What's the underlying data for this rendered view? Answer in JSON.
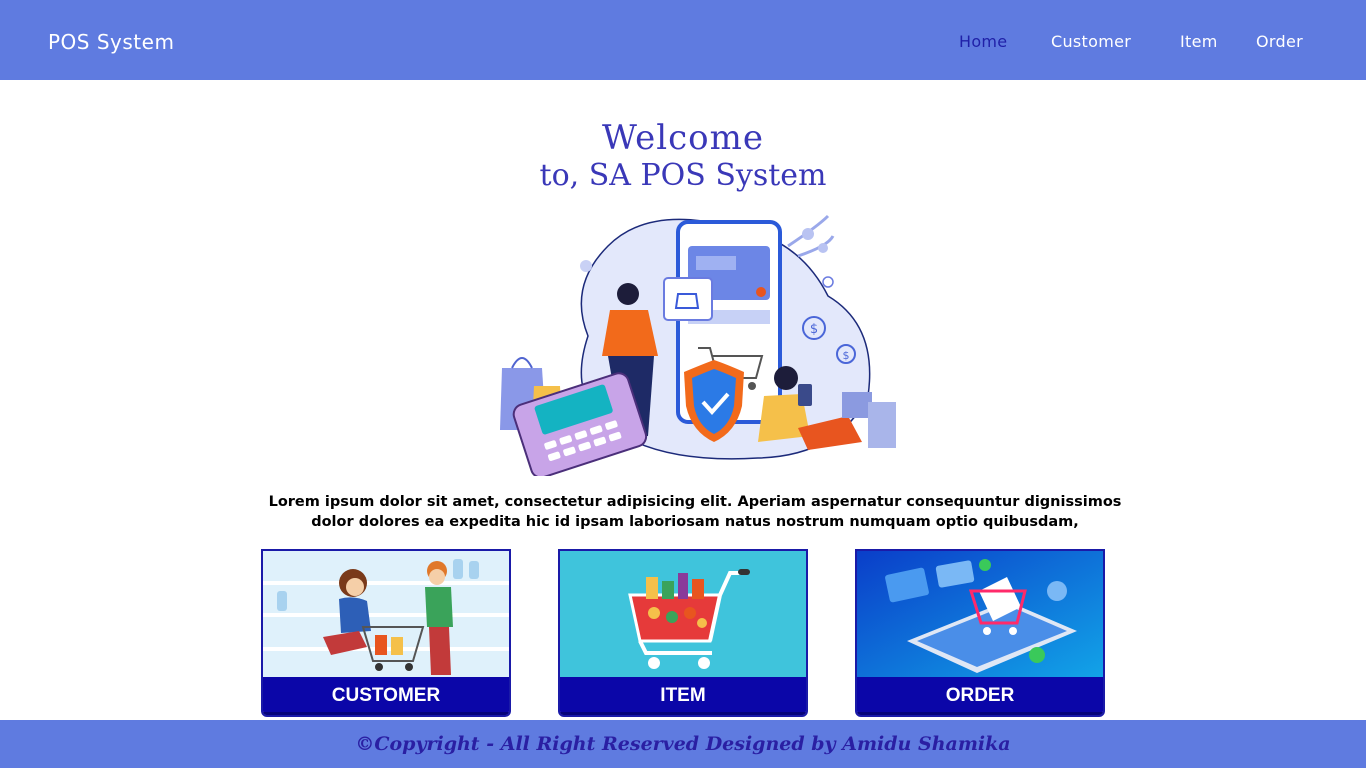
{
  "nav": {
    "brand": "POS System",
    "links": [
      {
        "label": "Home",
        "active": true
      },
      {
        "label": "Customer",
        "active": false
      },
      {
        "label": "Item",
        "active": false
      },
      {
        "label": "Order",
        "active": false
      }
    ]
  },
  "hero": {
    "welcome": "Welcome",
    "subtitle": "to, SA POS System",
    "description_line1": "Lorem ipsum dolor sit amet, consectetur adipisicing elit. Aperiam aspernatur consequuntur dignissimos",
    "description_line2": "dolor dolores ea expedita hic id ipsam laboriosam natus nostrum numquam optio quibusdam,"
  },
  "cards": [
    {
      "label": "CUSTOMER",
      "icon": "shoppers-cart-illustration"
    },
    {
      "label": "ITEM",
      "icon": "grocery-cart-illustration"
    },
    {
      "label": "ORDER",
      "icon": "mobile-shopping-illustration"
    }
  ],
  "footer": {
    "text": "©Copyright - All Right Reserved Designed by Amidu Shamika"
  },
  "colors": {
    "nav_bg": "#5f7be0",
    "accent": "#3a38b8",
    "card_bar": "#0b06a8"
  }
}
